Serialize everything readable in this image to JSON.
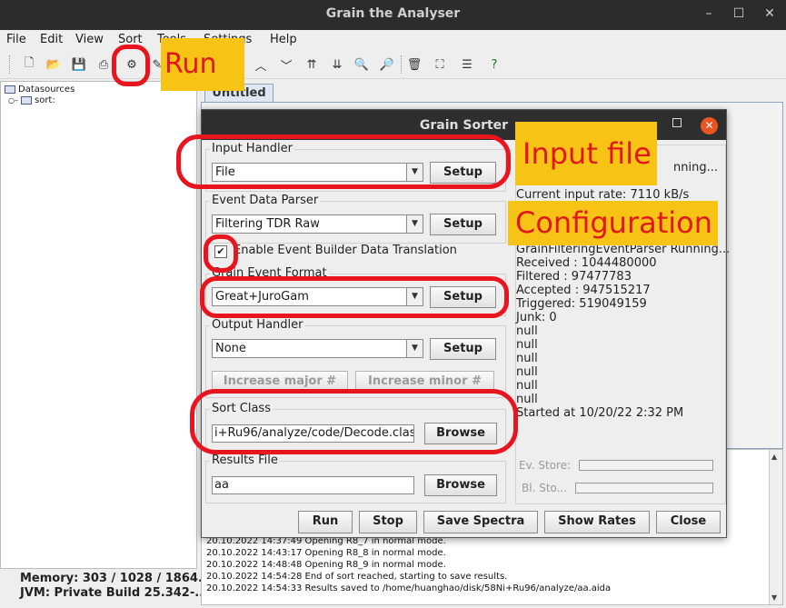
{
  "window": {
    "title": "Grain the Analyser"
  },
  "menu": [
    "File",
    "Edit",
    "View",
    "Sort",
    "Tools",
    "Settings",
    "Help"
  ],
  "tree": {
    "root": "Datasources",
    "child": "sort:"
  },
  "main_tab": "Untitled",
  "memory": {
    "memory": "Memory: 303 / 1028 / 1864...",
    "jvm": "JVM: Private Build 25.342-..."
  },
  "log_lines": [
    "20.10.2022 14:37:49 Opening R8_7 in normal mode.",
    "20.10.2022 14:43:17 Opening R8_8 in normal mode.",
    "20.10.2022 14:48:48 Opening R8_9 in normal mode.",
    "20.10.2022 14:54:28 End of sort reached, starting to save results.",
    "20.10.2022 14:54:33 Results saved to /home/huanghao/disk/58Ni+Ru96/analyze/aa.aida"
  ],
  "dialog": {
    "title": "Grain Sorter",
    "input_handler": {
      "label": "Input Handler",
      "value": "File",
      "setup": "Setup"
    },
    "event_parser": {
      "label": "Event Data Parser",
      "value": "Filtering TDR Raw",
      "setup": "Setup"
    },
    "event_builder": {
      "label": "Enable Event Builder Data Translation",
      "checked": true
    },
    "event_format": {
      "label": "Grain Event Format",
      "value": "Great+JuroGam",
      "setup": "Setup"
    },
    "output_handler": {
      "label": "Output Handler",
      "value": "None",
      "setup": "Setup"
    },
    "increase_major": "Increase major #",
    "increase_minor": "Increase minor #",
    "sort_class": {
      "label": "Sort Class",
      "value": "i+Ru96/analyze/code/Decode.class",
      "browse": "Browse"
    },
    "results_file": {
      "label": "Results File",
      "value": "aa",
      "browse": "Browse"
    },
    "status": {
      "heading": "S",
      "lines": [
        "nning...",
        "Current input rate: 7110 kB/s",
        "GrainFilteringEventParser Running...",
        "Received : 1044480000",
        "Filtered : 97477783",
        "Accepted : 947515217",
        "Triggered: 519049159",
        "Junk: 0",
        "null",
        "null",
        "null",
        "null",
        "null",
        "null",
        "Started at 10/20/22 2:32 PM"
      ],
      "ev_store": "Ev. Store:",
      "bl_store": "Bl. Sto..."
    },
    "buttons": {
      "run": "Run",
      "stop": "Stop",
      "save": "Save Spectra",
      "rates": "Show Rates",
      "close": "Close"
    }
  },
  "annotations": {
    "run": "Run",
    "input_file": "Input file",
    "configuration": "Configuration"
  },
  "colors": {
    "annotation_red": "#e8141e",
    "annotation_yellow": "#f7c415",
    "dark_title": "#2c2c2c",
    "close_orange": "#e95420"
  }
}
